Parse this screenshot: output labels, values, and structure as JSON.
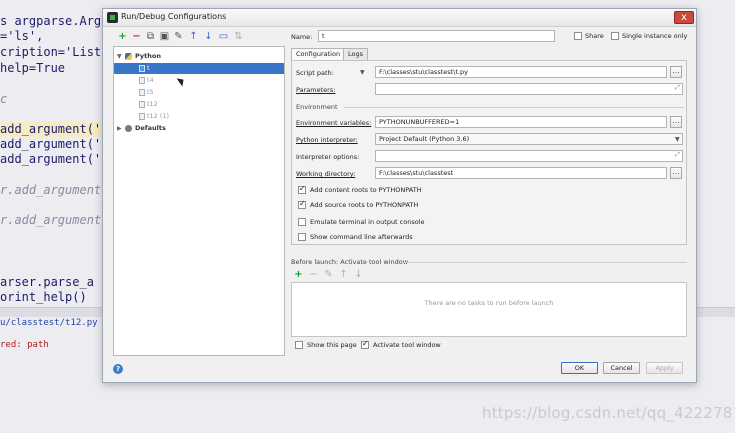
{
  "editor": {
    "lines": [
      {
        "text": "s argparse.Arg",
        "style": "normal"
      },
      {
        "text": "='ls',",
        "style": "normal"
      },
      {
        "text": "cription='List",
        "style": "normal"
      },
      {
        "text": "help=True",
        "style": "normal"
      },
      {
        "text": "c",
        "style": "gray"
      },
      {
        "text": "add_argument('",
        "style": "hl"
      },
      {
        "text": "add_argument('",
        "style": "normal"
      },
      {
        "text": "add_argument('",
        "style": "normal"
      },
      {
        "text": "r.add_argument",
        "style": "gray"
      },
      {
        "text": "r.add_argument",
        "style": "gray"
      },
      {
        "text": "arser.parse_a",
        "style": "normal"
      },
      {
        "text": "orint_help()",
        "style": "normal"
      }
    ],
    "tab_label": "u/classtest/t12.py",
    "error_label": "red: path"
  },
  "watermark": "https://blog.csdn.net/qq_42227818",
  "dialog": {
    "title": "Run/Debug Configurations",
    "close_glyph": "x",
    "toolbar_icons": [
      {
        "name": "add-icon",
        "glyph": "+"
      },
      {
        "name": "remove-icon",
        "glyph": "−"
      },
      {
        "name": "copy-icon",
        "glyph": "⧉"
      },
      {
        "name": "save-icon",
        "glyph": "▣"
      },
      {
        "name": "wrench-icon",
        "glyph": "✎"
      },
      {
        "name": "move-up-icon",
        "glyph": "↑"
      },
      {
        "name": "move-down-icon",
        "glyph": "↓"
      },
      {
        "name": "folder-icon",
        "glyph": "▭"
      },
      {
        "name": "sort-icon",
        "glyph": "⇅"
      }
    ],
    "tree": {
      "python_group": "Python",
      "items": [
        "t",
        "t4",
        "t5",
        "t12",
        "t12 (1)"
      ],
      "selected_item": "t",
      "defaults_group": "Defaults"
    },
    "name_label": "Name:",
    "name_value": "t",
    "share_label": "Share",
    "single_instance_label": "Single instance only",
    "tabs": [
      "Configuration",
      "Logs"
    ],
    "active_tab": "Configuration",
    "script_path_label": "Script path:",
    "script_path_value": "F:\\classes\\stu\\classtest\\t.py",
    "parameters_label": "Parameters:",
    "parameters_value": "",
    "environment_label": "Environment",
    "env_vars_label": "Environment variables:",
    "env_vars_value": "PYTHONUNBUFFERED=1",
    "interpreter_label": "Python interpreter:",
    "interpreter_value": "Project Default (Python 3.6)",
    "interpreter_options_label": "Interpreter options:",
    "interpreter_options_value": "",
    "working_dir_label": "Working directory:",
    "working_dir_value": "F:\\classes\\stu\\classtest",
    "checkboxes": [
      {
        "label": "Add content roots to PYTHONPATH",
        "checked": true
      },
      {
        "label": "Add source roots to PYTHONPATH",
        "checked": true
      },
      {
        "label": "Emulate terminal in output console",
        "checked": false
      },
      {
        "label": "Show command line afterwards",
        "checked": false
      }
    ],
    "before_launch_label": "Before launch: Activate tool window",
    "task_toolbar_icons": [
      "+",
      "−",
      "✎",
      "↑",
      "↓"
    ],
    "tasks_empty_text": "There are no tasks to run before launch",
    "show_page_label": "Show this page",
    "show_page_checked": false,
    "activate_tool_label": "Activate tool window",
    "activate_tool_checked": true,
    "help_glyph": "?",
    "ok_label": "OK",
    "cancel_label": "Cancel",
    "apply_label": "Apply"
  }
}
